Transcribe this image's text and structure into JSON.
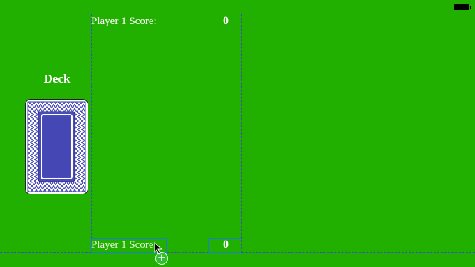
{
  "status_bar": {
    "battery_icon": "battery-icon"
  },
  "top_score": {
    "label": "Player 1 Score:",
    "value": "0"
  },
  "bottom_score": {
    "label": "Player 1 Score:",
    "value": "0"
  },
  "deck": {
    "title": "Deck",
    "card_back_color": "#4a4cb8"
  },
  "colors": {
    "table": "#22b000",
    "guides": "#3a4dc8",
    "selection": "#1b7fc9"
  },
  "icons": {
    "add": "plus-circle-icon",
    "cursor": "cursor-arrow-icon"
  }
}
